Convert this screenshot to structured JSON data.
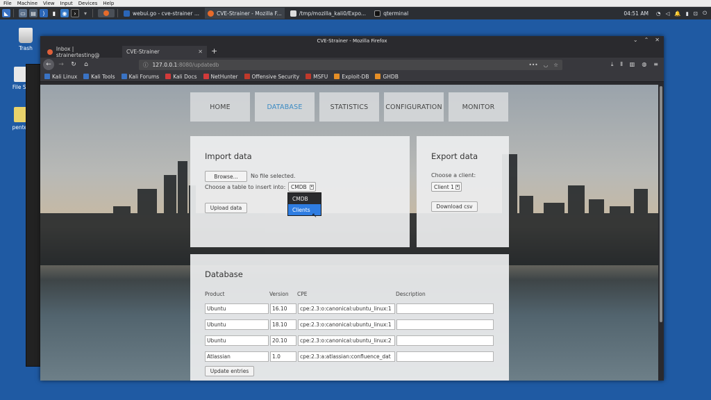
{
  "vm_menu": [
    "File",
    "Machine",
    "View",
    "Input",
    "Devices",
    "Help"
  ],
  "taskbar": {
    "tasks": [
      {
        "label": "webui.go - cve-strainer ..."
      },
      {
        "label": "CVE-Strainer - Mozilla F..."
      },
      {
        "label": "/tmp/mozilla_kali0/Expo..."
      },
      {
        "label": "qterminal"
      }
    ],
    "clock": "04:51 AM"
  },
  "desktop": {
    "icons": [
      {
        "label": "Trash"
      },
      {
        "label": "File Sy"
      },
      {
        "label": "penter"
      }
    ]
  },
  "browser": {
    "window_title": "CVE-Strainer - Mozilla Firefox",
    "tabs": [
      {
        "label": "Inbox | strainertesting@"
      },
      {
        "label": "CVE-Strainer"
      }
    ],
    "url_host": "127.0.0.1",
    "url_rest": ":8080/updatedb",
    "bookmarks": [
      "Kali Linux",
      "Kali Tools",
      "Kali Forums",
      "Kali Docs",
      "NetHunter",
      "Offensive Security",
      "MSFU",
      "Exploit-DB",
      "GHDB"
    ]
  },
  "nav": {
    "items": [
      {
        "label": "HOME"
      },
      {
        "label": "DATABASE"
      },
      {
        "label": "STATISTICS"
      },
      {
        "label": "CONFIGURATION"
      },
      {
        "label": "MONITOR"
      }
    ]
  },
  "import": {
    "title": "Import data",
    "browse_label": "Browse...",
    "file_status": "No file selected.",
    "table_label": "Choose a table to insert into:",
    "table_selected": "CMDB",
    "table_options": [
      "CMDB",
      "Clients"
    ],
    "upload_label": "Upload data"
  },
  "export": {
    "title": "Export data",
    "client_label": "Choose a client:",
    "client_selected": "Client 1",
    "download_label": "Download csv"
  },
  "database": {
    "title": "Database",
    "columns": [
      "Product",
      "Version",
      "CPE",
      "Description"
    ],
    "rows": [
      {
        "product": "Ubuntu",
        "version": "16.10",
        "cpe": "cpe:2.3:o:canonical:ubuntu_linux:1",
        "description": ""
      },
      {
        "product": "Ubuntu",
        "version": "18.10",
        "cpe": "cpe:2.3:o:canonical:ubuntu_linux:1",
        "description": ""
      },
      {
        "product": "Ubuntu",
        "version": "20.10",
        "cpe": "cpe:2.3:o:canonical:ubuntu_linux:2",
        "description": ""
      },
      {
        "product": "Atlassian",
        "version": "1.0",
        "cpe": "cpe:2.3:a:atlassian:confluence_dat",
        "description": ""
      }
    ],
    "update_label": "Update entries"
  }
}
